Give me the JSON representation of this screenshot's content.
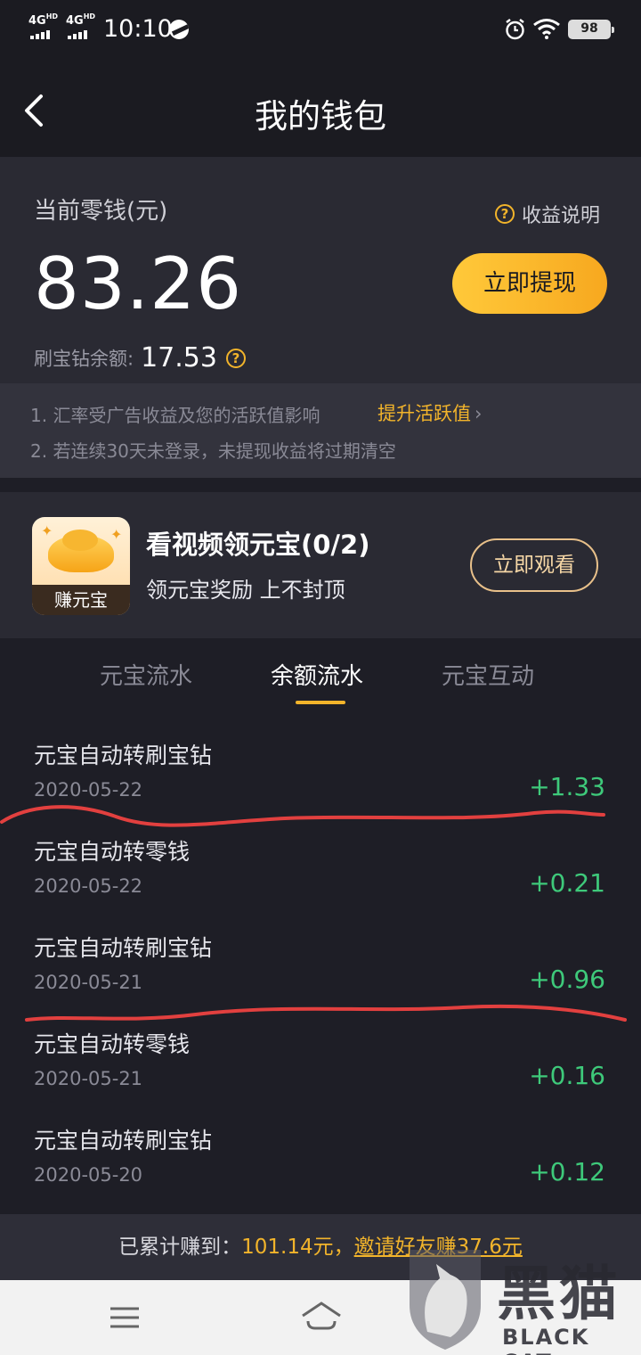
{
  "status_bar": {
    "signal1": "4G",
    "signal1_sup": "HD",
    "signal2": "4G",
    "signal2_sup": "HD",
    "time": "10:10",
    "battery": "98"
  },
  "header": {
    "title": "我的钱包"
  },
  "balance": {
    "label": "当前零钱(元)",
    "help_label": "收益说明",
    "amount": "83.26",
    "withdraw_label": "立即提现",
    "diamond_label": "刷宝钻余额:",
    "diamond_value": "17.53"
  },
  "notes": {
    "note1": "1. 汇率受广告收益及您的活跃值影响",
    "boost_link": "提升活跃值",
    "note2": "2. 若连续30天未登录，未提现收益将过期清空"
  },
  "task": {
    "icon_badge": "赚元宝",
    "title": "看视频领元宝(0/2)",
    "subtitle": "领元宝奖励 上不封顶",
    "button": "立即观看"
  },
  "tabs": [
    {
      "label": "元宝流水"
    },
    {
      "label": "余额流水"
    },
    {
      "label": "元宝互动"
    }
  ],
  "active_tab": "余额流水",
  "transactions": [
    {
      "title": "元宝自动转刷宝钻",
      "date": "2020-05-22",
      "amount": "+1.33"
    },
    {
      "title": "元宝自动转零钱",
      "date": "2020-05-22",
      "amount": "+0.21"
    },
    {
      "title": "元宝自动转刷宝钻",
      "date": "2020-05-21",
      "amount": "+0.96"
    },
    {
      "title": "元宝自动转零钱",
      "date": "2020-05-21",
      "amount": "+0.16"
    },
    {
      "title": "元宝自动转刷宝钻",
      "date": "2020-05-20",
      "amount": "+0.12"
    }
  ],
  "summary": {
    "label": "已累计赚到：",
    "amount": "101.14元，",
    "invite": "邀请好友赚37.6元"
  },
  "watermark": {
    "cn": "黑猫",
    "en": "BLACK CAT"
  },
  "colors": {
    "accent": "#f2b42b",
    "positive": "#3ec97a",
    "scribble": "#e2403f"
  }
}
